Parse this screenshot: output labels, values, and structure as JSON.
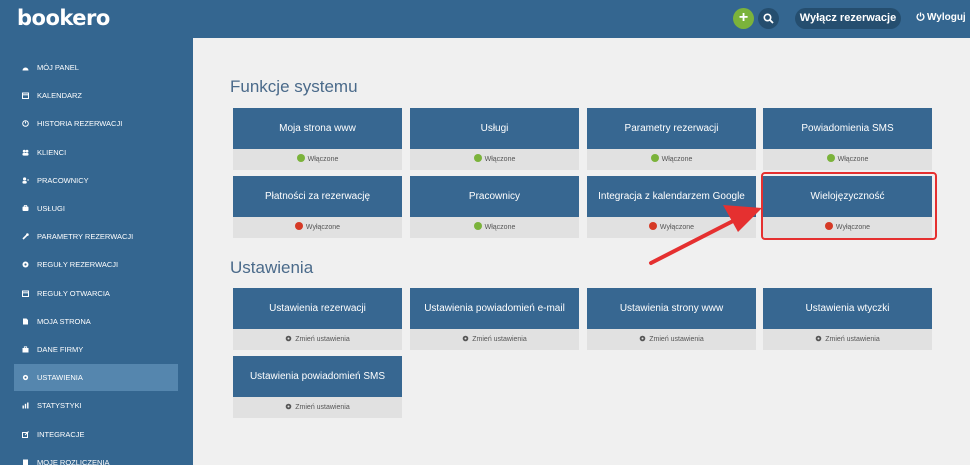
{
  "header": {
    "logo_text": "bookero",
    "add_label": "+",
    "disable_reservations_label": "Wyłącz rezerwacje",
    "logout_label": "Wyloguj"
  },
  "sidebar": {
    "items": [
      {
        "label": "MÓJ PANEL",
        "icon": "dashboard-icon"
      },
      {
        "label": "KALENDARZ",
        "icon": "calendar-icon"
      },
      {
        "label": "HISTORIA REZERWACJI",
        "icon": "history-icon"
      },
      {
        "label": "KLIENCI",
        "icon": "users-icon"
      },
      {
        "label": "PRACOWNICY",
        "icon": "user-plus-icon"
      },
      {
        "label": "USŁUGI",
        "icon": "services-icon"
      },
      {
        "label": "PARAMETRY REZERWACJI",
        "icon": "wrench-icon"
      },
      {
        "label": "REGUŁY REZERWACJI",
        "icon": "rule-icon"
      },
      {
        "label": "REGUŁY OTWARCIA",
        "icon": "calendar-icon"
      },
      {
        "label": "MOJA STRONA",
        "icon": "page-icon"
      },
      {
        "label": "DANE FIRMY",
        "icon": "briefcase-icon"
      },
      {
        "label": "USTAWIENIA",
        "icon": "gear-icon"
      },
      {
        "label": "STATYSTYKI",
        "icon": "stats-icon"
      },
      {
        "label": "INTEGRACJE",
        "icon": "external-link-icon"
      },
      {
        "label": "MOJE ROZLICZENIA",
        "icon": "billing-icon"
      }
    ],
    "active_index": 11
  },
  "features": {
    "title": "Funkcje systemu",
    "cards": [
      {
        "label": "Moja strona www",
        "status": "Włączone",
        "status_color": "#7bb33b"
      },
      {
        "label": "Usługi",
        "status": "Włączone",
        "status_color": "#7bb33b"
      },
      {
        "label": "Parametry rezerwacji",
        "status": "Włączone",
        "status_color": "#7bb33b"
      },
      {
        "label": "Powiadomienia SMS",
        "status": "Włączone",
        "status_color": "#7bb33b"
      },
      {
        "label": "Płatności za rezerwację",
        "status": "Wyłączone",
        "status_color": "#d63a26"
      },
      {
        "label": "Pracownicy",
        "status": "Włączone",
        "status_color": "#7bb33b"
      },
      {
        "label": "Integracja z kalendarzem Google",
        "status": "Wyłączone",
        "status_color": "#d63a26"
      },
      {
        "label": "Wielojęzyczność",
        "status": "Wyłączone",
        "status_color": "#d63a26"
      }
    ]
  },
  "settings": {
    "title": "Ustawienia",
    "cards": [
      {
        "label": "Ustawienia rezerwacji",
        "action": "Zmień ustawienia"
      },
      {
        "label": "Ustawienia powiadomień e-mail",
        "action": "Zmień ustawienia"
      },
      {
        "label": "Ustawienia strony www",
        "action": "Zmień ustawienia"
      },
      {
        "label": "Ustawienia wtyczki",
        "action": "Zmień ustawienia"
      },
      {
        "label": "Ustawienia powiadomień SMS",
        "action": "Zmień ustawienia"
      }
    ]
  },
  "colors": {
    "brand": "#346690",
    "enabled": "#7bb33b",
    "disabled": "#d63a26",
    "annotation": "#e53030"
  }
}
